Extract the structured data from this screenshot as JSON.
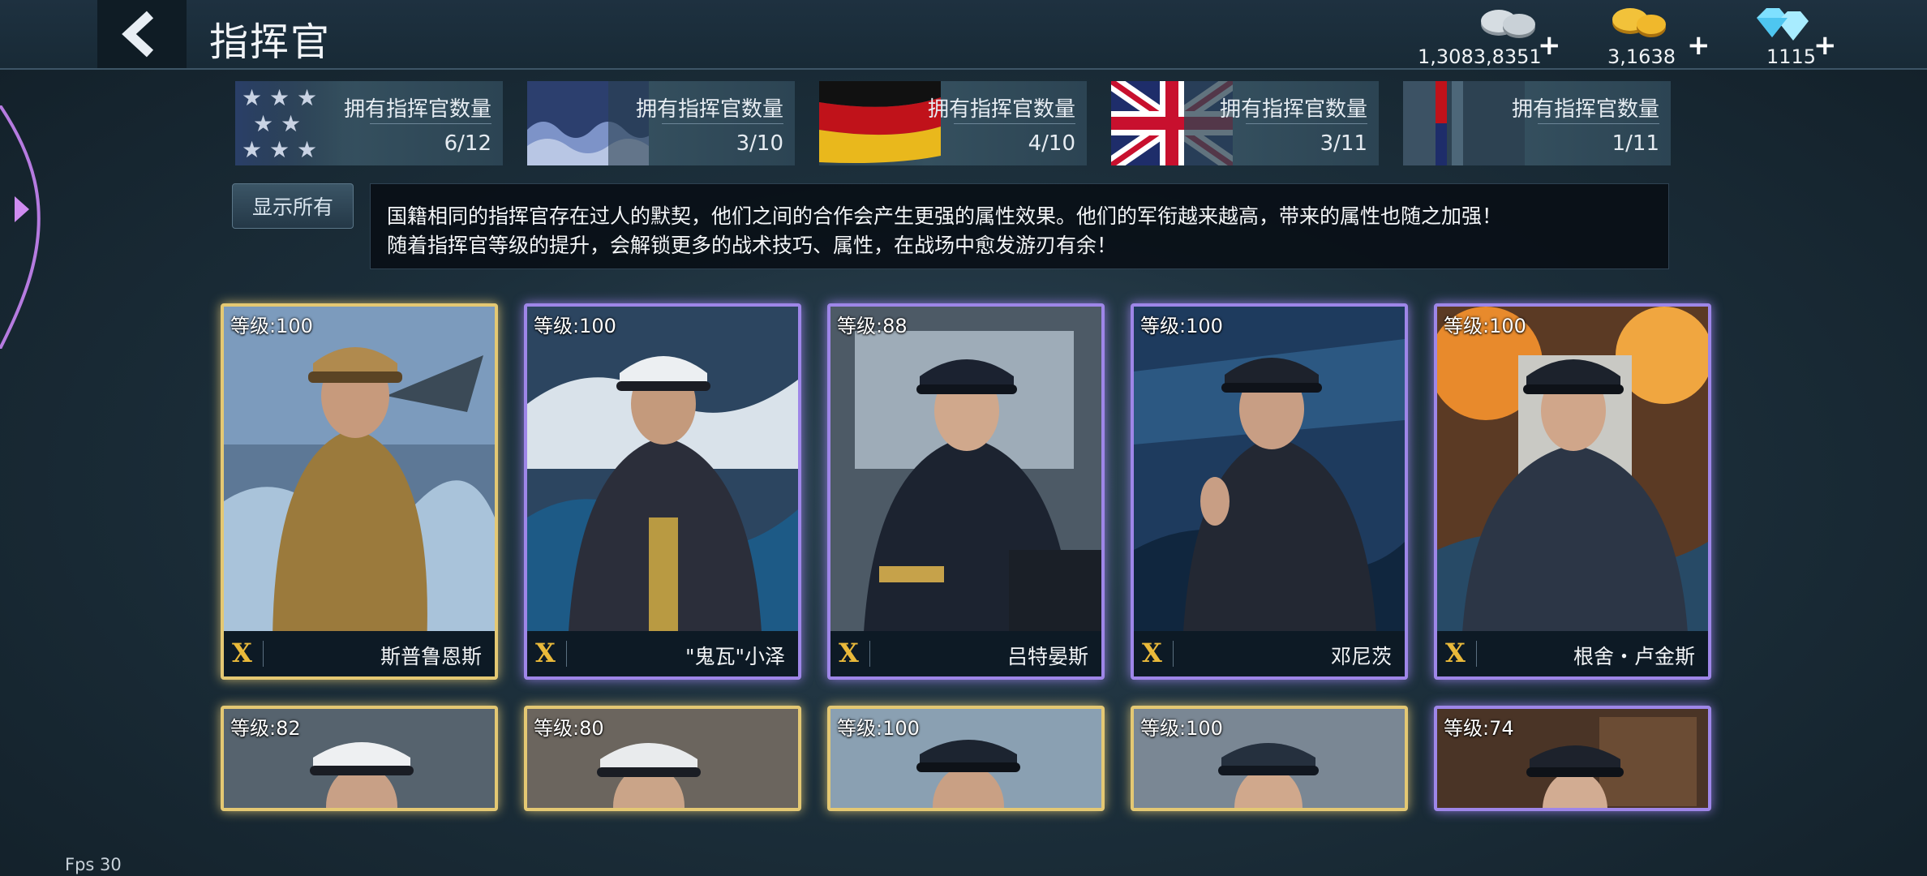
{
  "header": {
    "title": "指挥官"
  },
  "currencies": [
    {
      "name": "silver",
      "icon": "silver-coins-icon",
      "amount": "1,3083,8351",
      "plus": "+"
    },
    {
      "name": "gold",
      "icon": "gold-coins-icon",
      "amount": "3,1638",
      "plus": "+"
    },
    {
      "name": "diamond",
      "icon": "diamond-icon",
      "amount": "1115",
      "plus": "+"
    }
  ],
  "nations": [
    {
      "flag": "usa-flag",
      "label": "拥有指挥官数量",
      "count": "6/12"
    },
    {
      "flag": "japan-flag",
      "label": "拥有指挥官数量",
      "count": "3/10"
    },
    {
      "flag": "germany-flag",
      "label": "拥有指挥官数量",
      "count": "4/10"
    },
    {
      "flag": "uk-flag",
      "label": "拥有指挥官数量",
      "count": "3/11"
    },
    {
      "flag": "other-flag",
      "label": "拥有指挥官数量",
      "count": "1/11"
    }
  ],
  "filter": {
    "show_all_label": "显示所有"
  },
  "info": {
    "line1": "国籍相同的指挥官存在过人的默契，他们之间的合作会产生更强的属性效果。他们的军衔越来越高，带来的属性也随之加强！",
    "line2": "随着指挥官等级的提升，会解锁更多的战术技巧、属性，在战场中愈发游刃有余！"
  },
  "commanders": [
    {
      "level": "等级:100",
      "rank": "X",
      "name": "斯普鲁恩斯",
      "frame": "gold"
    },
    {
      "level": "等级:100",
      "rank": "X",
      "name": "\"鬼瓦\"小泽",
      "frame": "purple"
    },
    {
      "level": "等级:88",
      "rank": "X",
      "name": "吕特晏斯",
      "frame": "purple"
    },
    {
      "level": "等级:100",
      "rank": "X",
      "name": "邓尼茨",
      "frame": "purple"
    },
    {
      "level": "等级:100",
      "rank": "X",
      "name": "根舍・卢金斯",
      "frame": "purple"
    },
    {
      "level": "等级:82",
      "frame": "gold"
    },
    {
      "level": "等级:80",
      "frame": "gold"
    },
    {
      "level": "等级:100",
      "frame": "gold"
    },
    {
      "level": "等级:100",
      "frame": "gold"
    },
    {
      "level": "等级:74",
      "frame": "purple"
    }
  ],
  "colors": {
    "gold_frame": "#e4c873",
    "purple_frame": "#9e86e8",
    "rank_gold": "#e9b93a"
  },
  "debug": {
    "fps": "Fps 30"
  }
}
